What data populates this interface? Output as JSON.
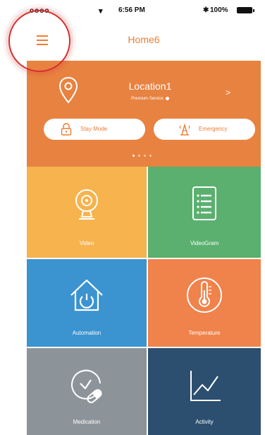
{
  "status_bar": {
    "signal": "oooo",
    "time": "6:56 PM",
    "battery": "100%"
  },
  "nav": {
    "title": "Home6"
  },
  "location": {
    "name": "Location1",
    "service": "Premium Service",
    "chevron": ">"
  },
  "modes": {
    "stay_label": "Stay Mode",
    "emergency_label": "Emergency"
  },
  "tiles": [
    {
      "label": "Video",
      "color": "#f6b34e",
      "icon": "webcam-icon"
    },
    {
      "label": "VideoGram",
      "color": "#5bb06f",
      "icon": "video-list-icon"
    },
    {
      "label": "Automation",
      "color": "#3b93cf",
      "icon": "home-power-icon"
    },
    {
      "label": "Temperature",
      "color": "#f0824b",
      "icon": "thermometer-icon"
    },
    {
      "label": "Medication",
      "color": "#8d9499",
      "icon": "medication-clock-icon"
    },
    {
      "label": "Activity",
      "color": "#2c4f70",
      "icon": "activity-chart-icon"
    }
  ],
  "colors": {
    "accent": "#ee7d33",
    "panel": "#e88241",
    "highlight": "#d32f2f"
  }
}
